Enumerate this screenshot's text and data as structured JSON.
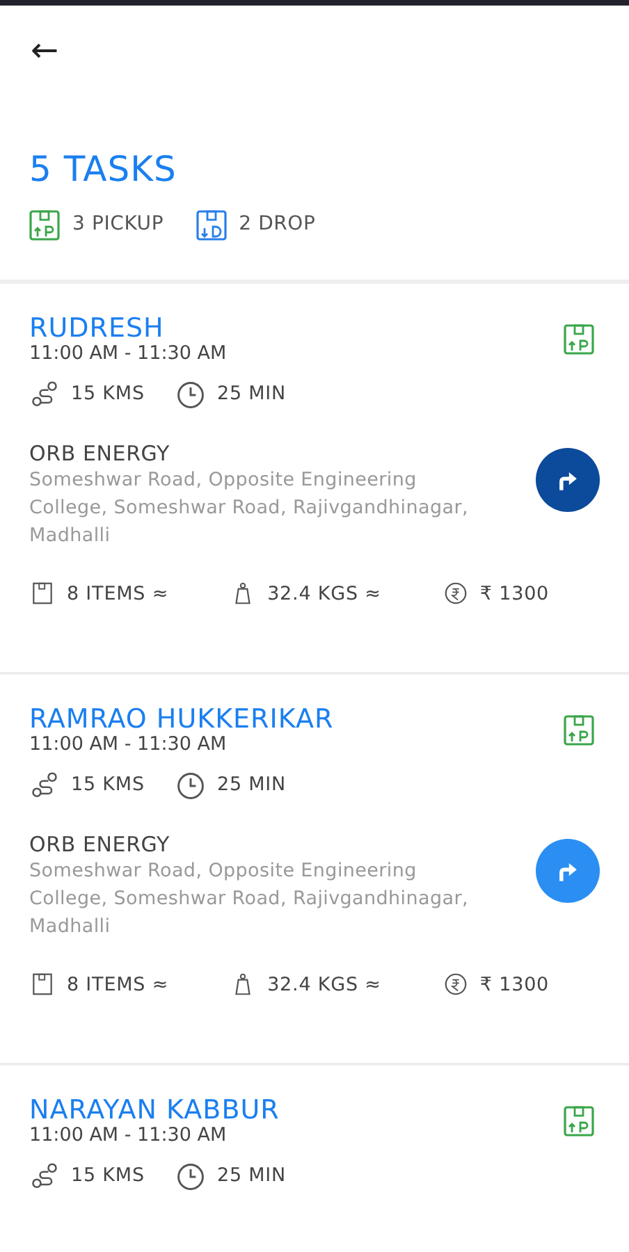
{
  "header": {
    "back": "←",
    "title": "5 TASKS",
    "summary": [
      {
        "kind": "pickup",
        "label": "3 PICKUP"
      },
      {
        "kind": "drop",
        "label": "2 DROP"
      }
    ]
  },
  "tasks": [
    {
      "name": "RUDRESH",
      "kind": "pickup",
      "time": "11:00 AM - 11:30 AM",
      "distance": "15 KMS",
      "duration": "25 MIN",
      "company": "ORB ENERGY",
      "address": "Someshwar Road, Opposite Engineering College, Someshwar Road, Rajivgandhinagar, Madhalli",
      "items": "8 ITEMS ≈",
      "weight": "32.4 KGS ≈",
      "amount": "₹ 1300",
      "active": true
    },
    {
      "name": "RAMRAO HUKKERIKAR",
      "kind": "pickup",
      "time": "11:00 AM - 11:30 AM",
      "distance": "15 KMS",
      "duration": "25 MIN",
      "company": "ORB ENERGY",
      "address": "Someshwar Road, Opposite Engineering College, Someshwar Road, Rajivgandhinagar, Madhalli",
      "items": "8 ITEMS ≈",
      "weight": "32.4 KGS ≈",
      "amount": "₹ 1300",
      "active": false
    },
    {
      "name": "NARAYAN KABBUR",
      "kind": "pickup",
      "time": "11:00 AM - 11:30 AM",
      "distance": "15 KMS",
      "duration": "25 MIN"
    }
  ]
}
